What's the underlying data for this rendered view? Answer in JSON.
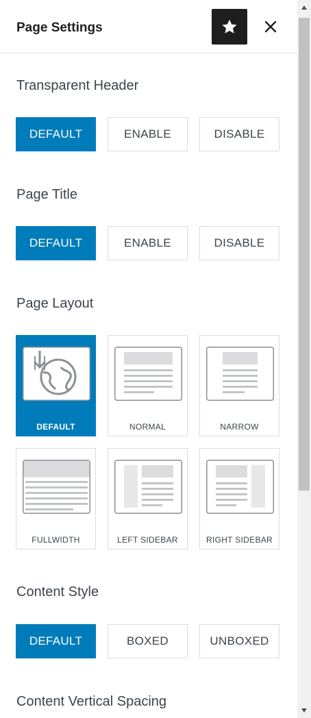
{
  "header": {
    "title": "Page Settings",
    "star_icon": "star-icon",
    "close_icon": "close-icon"
  },
  "sections": {
    "transparent_header": {
      "title": "Transparent Header",
      "options": [
        "DEFAULT",
        "ENABLE",
        "DISABLE"
      ],
      "selected": "DEFAULT"
    },
    "page_title": {
      "title": "Page Title",
      "options": [
        "DEFAULT",
        "ENABLE",
        "DISABLE"
      ],
      "selected": "DEFAULT"
    },
    "page_layout": {
      "title": "Page Layout",
      "options": [
        "DEFAULT",
        "NORMAL",
        "NARROW",
        "FULLWIDTH",
        "LEFT SIDEBAR",
        "RIGHT SIDEBAR"
      ],
      "selected": "DEFAULT"
    },
    "content_style": {
      "title": "Content Style",
      "options": [
        "DEFAULT",
        "BOXED",
        "UNBOXED"
      ],
      "selected": "DEFAULT"
    },
    "content_vertical_spacing": {
      "title": "Content Vertical Spacing"
    }
  },
  "colors": {
    "accent": "#007cba",
    "dark": "#1e1e1e",
    "border": "#dcdcde",
    "text": "#3c434a"
  }
}
